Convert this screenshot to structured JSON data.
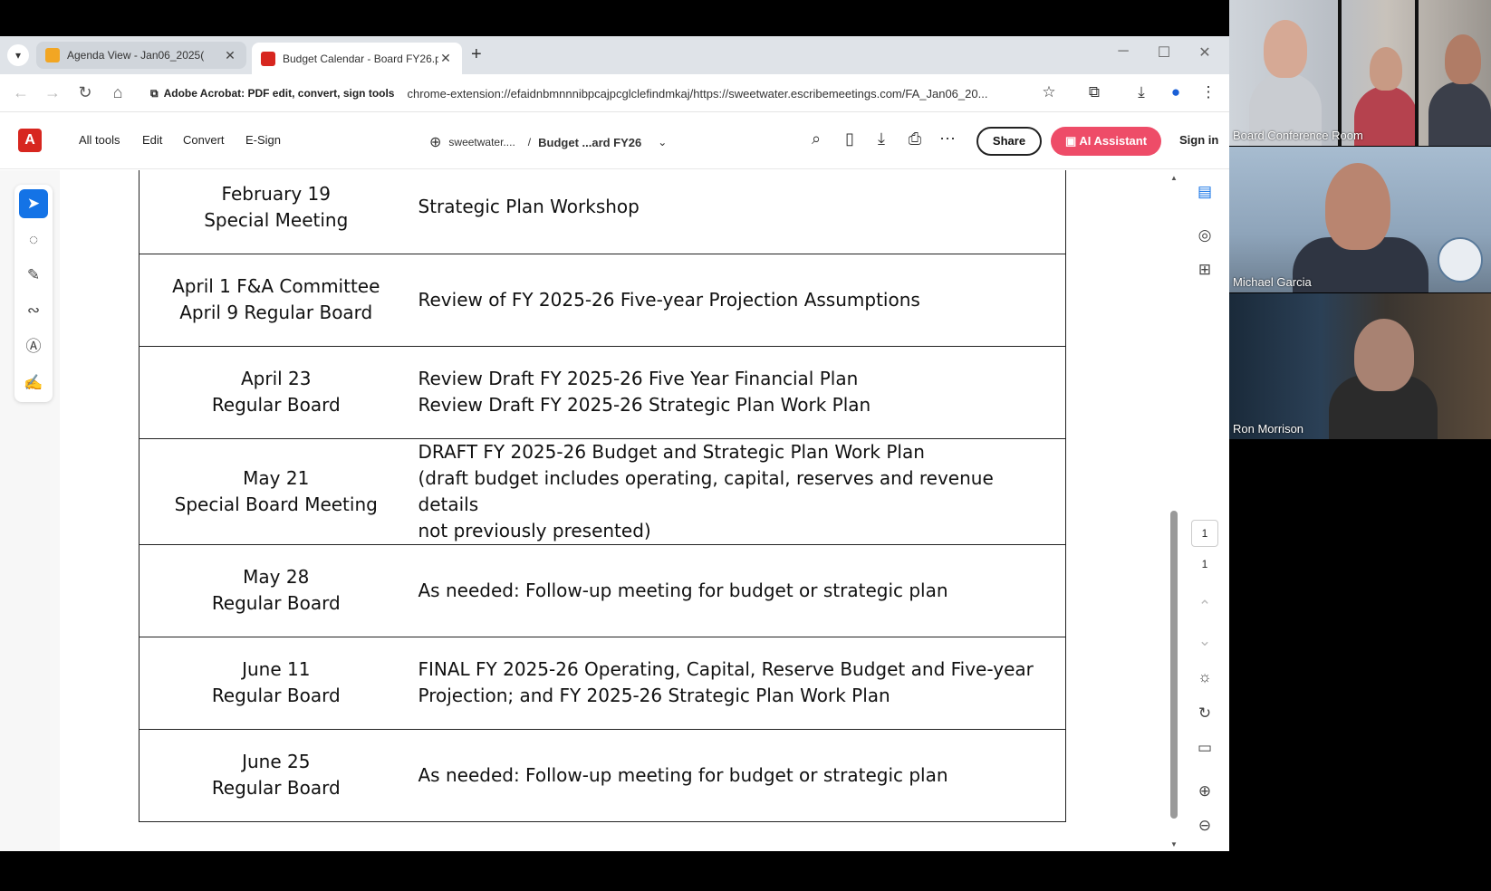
{
  "browser": {
    "tabs": [
      {
        "title": "Agenda View - Jan06_2025(",
        "favicon_color": "#f2a623",
        "active": false
      },
      {
        "title": "Budget Calendar - Board FY26.p",
        "favicon_color": "#d7261f",
        "active": true
      }
    ],
    "new_tab_symbol": "+",
    "extension_label": "Adobe Acrobat: PDF edit, convert, sign tools",
    "url": "chrome-extension://efaidnbmnnnibpcajpcglclefindmkaj/https://sweetwater.escribemeetings.com/FA_Jan06_20..."
  },
  "acrobat": {
    "menu": [
      "All tools",
      "Edit",
      "Convert",
      "E-Sign"
    ],
    "breadcrumb_site": "sweetwater....",
    "breadcrumb_sep": "/",
    "document_name": "Budget ...ard FY26",
    "share_label": "Share",
    "ai_label": "AI Assistant",
    "signin_label": "Sign in",
    "current_page": "1",
    "total_pages": "1"
  },
  "schedule": [
    {
      "date": [
        "February 19",
        "Special Meeting"
      ],
      "desc": [
        "Strategic Plan Workshop"
      ]
    },
    {
      "date": [
        "April 1 F&A Committee",
        "April 9 Regular Board"
      ],
      "desc": [
        "Review of FY 2025-26 Five-year Projection Assumptions"
      ]
    },
    {
      "date": [
        "April 23",
        "Regular Board"
      ],
      "desc": [
        "Review Draft FY 2025-26 Five Year Financial Plan",
        "Review Draft FY 2025-26 Strategic Plan Work Plan"
      ]
    },
    {
      "date": [
        "May 21",
        "Special Board Meeting"
      ],
      "desc": [
        "DRAFT FY 2025-26 Budget and Strategic Plan Work Plan",
        "(draft budget includes operating, capital, reserves and revenue details",
        "not previously presented)"
      ]
    },
    {
      "date": [
        "May 28",
        "Regular Board"
      ],
      "desc": [
        "As needed: Follow-up meeting for budget or strategic plan"
      ]
    },
    {
      "date": [
        "June 11",
        "Regular Board"
      ],
      "desc": [
        "FINAL FY 2025-26 Operating, Capital, Reserve Budget and Five-year",
        "Projection; and FY 2025-26 Strategic Plan Work Plan"
      ]
    },
    {
      "date": [
        "June 25",
        "Regular Board"
      ],
      "desc": [
        "As needed: Follow-up meeting for budget or strategic plan"
      ]
    }
  ],
  "video": {
    "participants": [
      "Board Conference Room",
      "Michael Garcia",
      "Ron Morrison"
    ]
  }
}
